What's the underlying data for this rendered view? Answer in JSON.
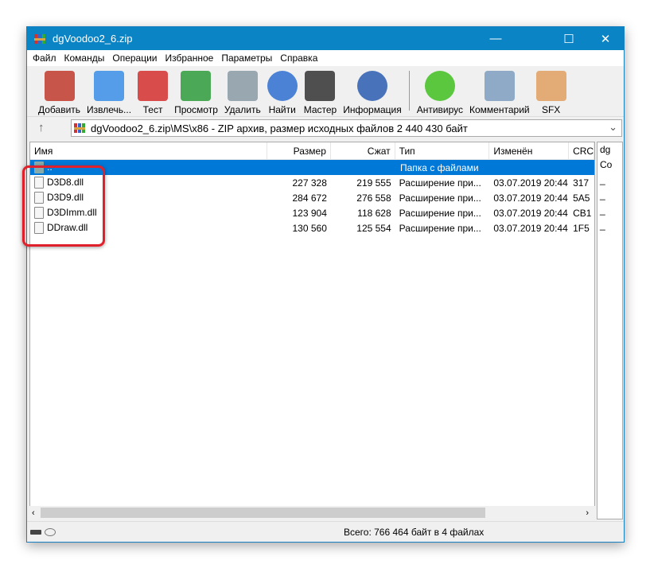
{
  "window": {
    "title": "dgVoodoo2_6.zip",
    "minimize": "—",
    "maximize": "☐",
    "close": "✕"
  },
  "menu": [
    "Файл",
    "Команды",
    "Операции",
    "Избранное",
    "Параметры",
    "Справка"
  ],
  "toolbar": [
    {
      "label": "Добавить",
      "icon": "archive-add-icon",
      "color": "#c0392b"
    },
    {
      "label": "Извлечь...",
      "icon": "folder-extract-icon",
      "color": "#3a8ee6"
    },
    {
      "label": "Тест",
      "icon": "clipboard-test-icon",
      "color": "#d32f2f"
    },
    {
      "label": "Просмотр",
      "icon": "book-view-icon",
      "color": "#2e9b3c"
    },
    {
      "label": "Удалить",
      "icon": "trash-icon",
      "color": "#8a9aa6"
    },
    {
      "label": "Найти",
      "icon": "magnifier-icon",
      "color": "#2f6fd0"
    },
    {
      "label": "Мастер",
      "icon": "wizard-wand-icon",
      "color": "#333333"
    },
    {
      "label": "Информация",
      "icon": "info-icon",
      "color": "#2a5db0"
    },
    {
      "label": "Антивирус",
      "icon": "antivirus-icon",
      "color": "#3fbf1f"
    },
    {
      "label": "Комментарий",
      "icon": "comment-icon",
      "color": "#7d9ec0"
    },
    {
      "label": "SFX",
      "icon": "sfx-box-icon",
      "color": "#e0a060"
    }
  ],
  "address": {
    "up": "↑",
    "path": "dgVoodoo2_6.zip\\MS\\x86 - ZIP архив, размер исходных файлов 2 440 430 байт",
    "dropdown": "⌄"
  },
  "columns": {
    "name": "Имя",
    "size": "Размер",
    "packed": "Сжат",
    "type": "Тип",
    "modified": "Изменён",
    "crc": "CRC"
  },
  "parent_row": {
    "name": "..",
    "type": "Папка с файлами"
  },
  "files": [
    {
      "name": "D3D8.dll",
      "size": "227 328",
      "packed": "219 555",
      "type": "Расширение при...",
      "modified": "03.07.2019 20:44",
      "crc": "317"
    },
    {
      "name": "D3D9.dll",
      "size": "284 672",
      "packed": "276 558",
      "type": "Расширение при...",
      "modified": "03.07.2019 20:44",
      "crc": "5A5"
    },
    {
      "name": "D3DImm.dll",
      "size": "123 904",
      "packed": "118 628",
      "type": "Расширение при...",
      "modified": "03.07.2019 20:44",
      "crc": "CB1"
    },
    {
      "name": "DDraw.dll",
      "size": "130 560",
      "packed": "125 554",
      "type": "Расширение при...",
      "modified": "03.07.2019 20:44",
      "crc": "1F5"
    }
  ],
  "side_panel": [
    "dg",
    "Co",
    "_",
    "_",
    "_",
    "_"
  ],
  "status": {
    "total": "Всего: 766 464 байт в 4 файлах"
  },
  "colors": {
    "titlebar": "#0b84c5",
    "selection": "#0078d7",
    "highlight": "#e0202a"
  }
}
